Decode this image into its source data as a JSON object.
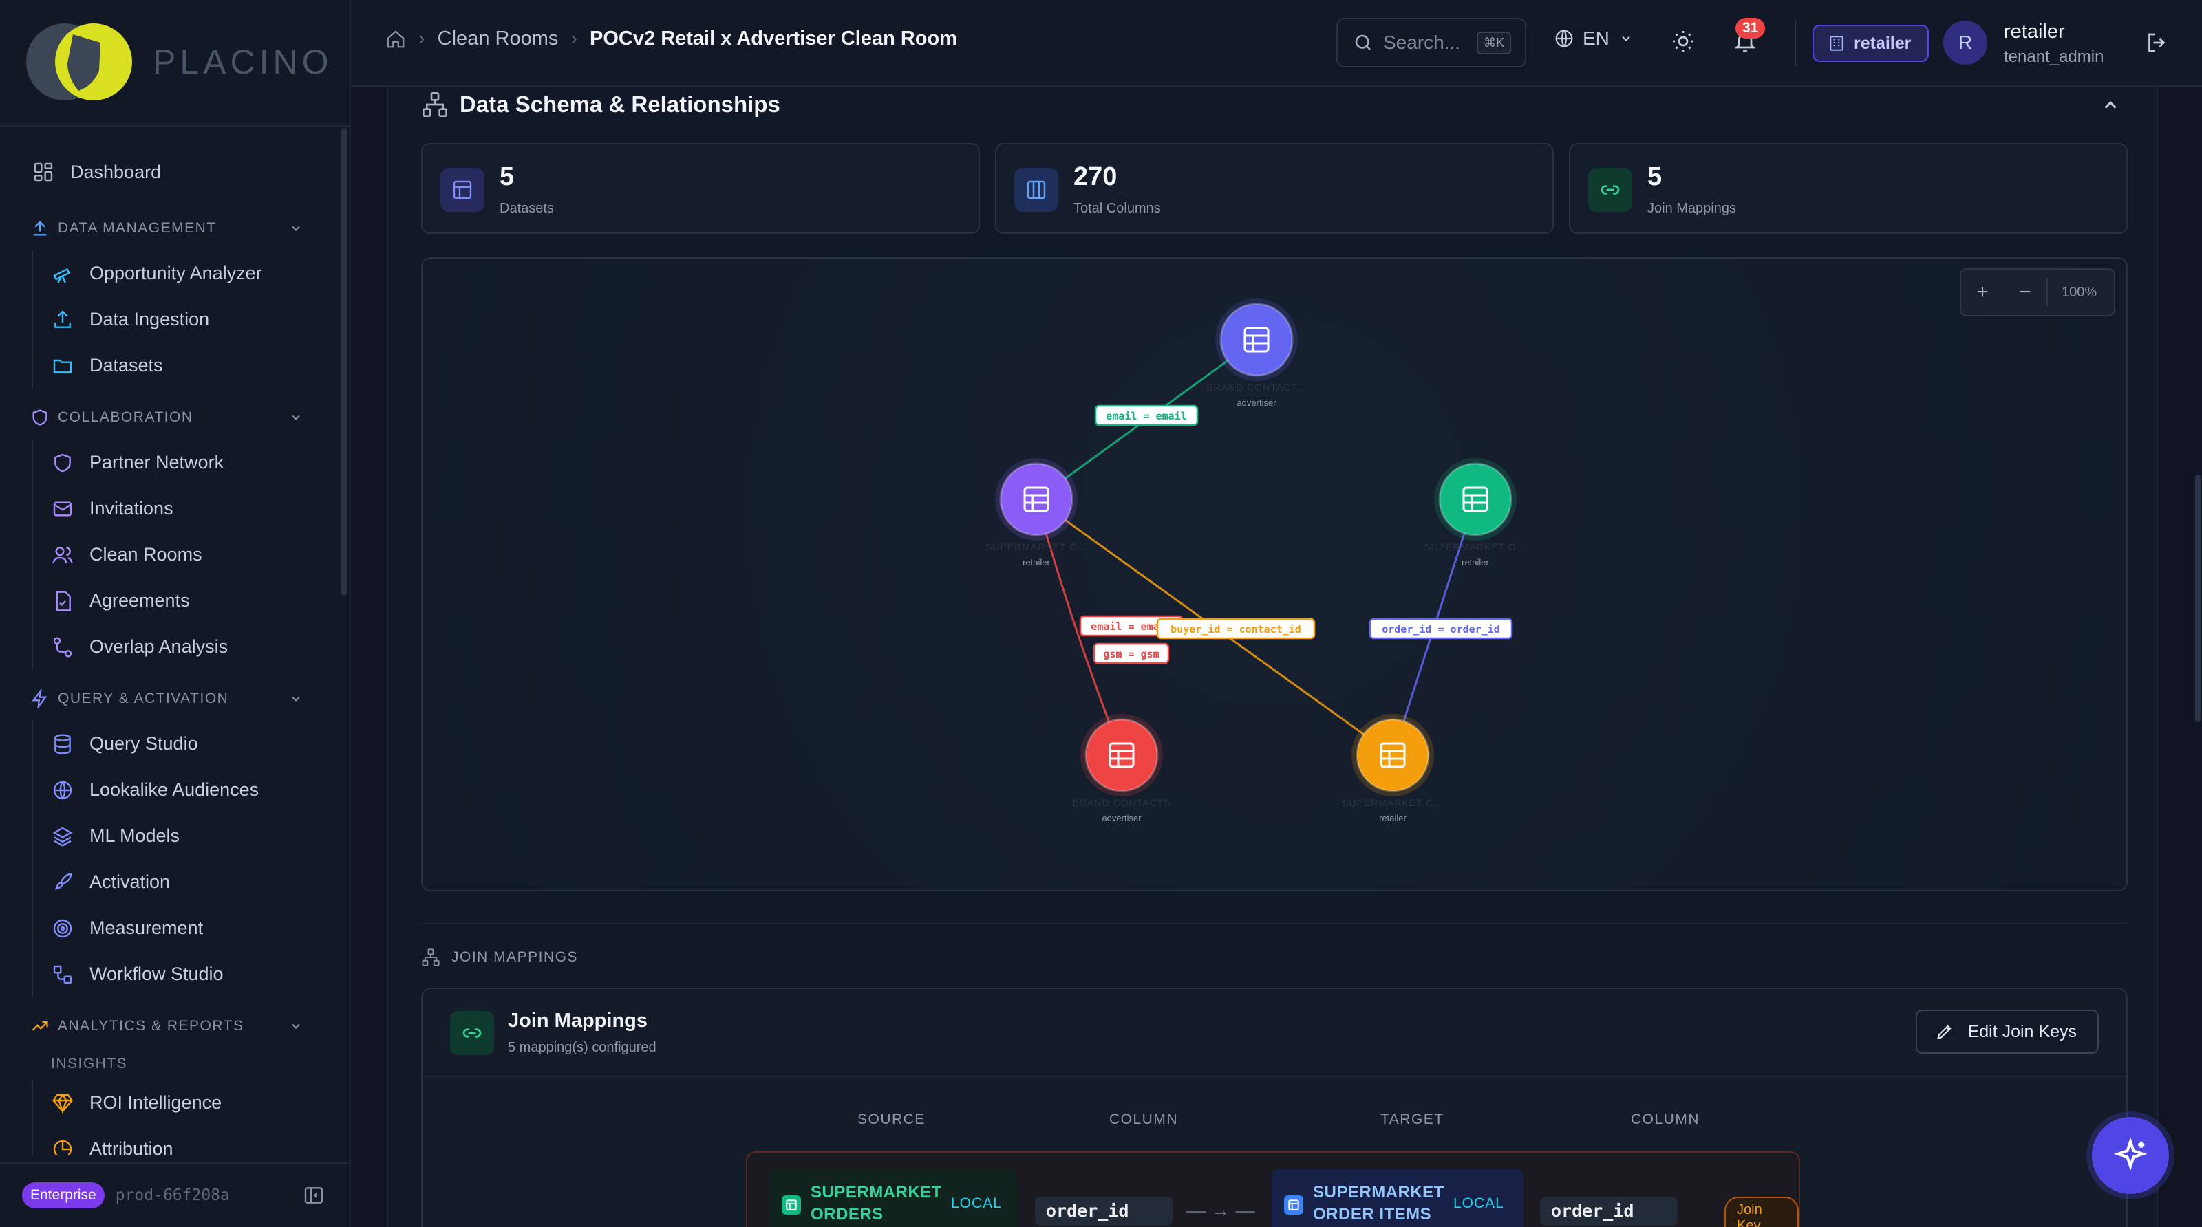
{
  "brand": {
    "name": "PLACINO"
  },
  "sidebar": {
    "dashboard": "Dashboard",
    "sections": [
      {
        "label": "DATA MANAGEMENT",
        "items": [
          "Opportunity Analyzer",
          "Data Ingestion",
          "Datasets"
        ]
      },
      {
        "label": "COLLABORATION",
        "items": [
          "Partner Network",
          "Invitations",
          "Clean Rooms",
          "Agreements",
          "Overlap Analysis"
        ]
      },
      {
        "label": "QUERY & ACTIVATION",
        "items": [
          "Query Studio",
          "Lookalike Audiences",
          "ML Models",
          "Activation",
          "Measurement",
          "Workflow Studio"
        ]
      },
      {
        "label": "ANALYTICS & REPORTS",
        "subsection": "INSIGHTS",
        "items": [
          "ROI Intelligence",
          "Attribution"
        ]
      }
    ],
    "footer": {
      "badge": "Enterprise",
      "env": "prod-66f208a"
    }
  },
  "topbar": {
    "breadcrumb": [
      "Clean Rooms",
      "POCv2 Retail x Advertiser Clean Room"
    ],
    "search_placeholder": "Search...",
    "search_shortcut": "⌘K",
    "language": "EN",
    "notifications": "31",
    "role_badge": "retailer",
    "avatar_initial": "R",
    "user_name": "retailer",
    "user_role": "tenant_admin"
  },
  "schema": {
    "title": "Data Schema & Relationships",
    "stats": [
      {
        "value": "5",
        "label": "Datasets"
      },
      {
        "value": "270",
        "label": "Total Columns"
      },
      {
        "value": "5",
        "label": "Join Mappings"
      }
    ],
    "zoom": {
      "plus": "+",
      "minus": "−",
      "level": "100%"
    },
    "nodes": [
      {
        "id": "n1",
        "name": "BRAND CONTACT...",
        "owner": "advertiser",
        "color": "#6366f1"
      },
      {
        "id": "n2",
        "name": "SUPERMARKET C...",
        "owner": "retailer",
        "color": "#8b5cf6"
      },
      {
        "id": "n3",
        "name": "SUPERMARKET O...",
        "owner": "retailer",
        "color": "#10b981"
      },
      {
        "id": "n4",
        "name": "BRAND CONTACTS",
        "owner": "advertiser",
        "color": "#ef4444"
      },
      {
        "id": "n5",
        "name": "SUPERMARKET C...",
        "owner": "retailer",
        "color": "#f59e0b"
      }
    ],
    "edges": [
      {
        "label": "email = email",
        "color": "#10b981"
      },
      {
        "label": "email = email",
        "color": "#ef4444"
      },
      {
        "label": "gsm = gsm",
        "color": "#ef4444"
      },
      {
        "label": "buyer_id = contact_id",
        "color": "#f59e0b"
      },
      {
        "label": "order_id = order_id",
        "color": "#6366f1"
      }
    ]
  },
  "join_mappings": {
    "section_label": "JOIN MAPPINGS",
    "title": "Join Mappings",
    "subtitle": "5 mapping(s) configured",
    "edit_button": "Edit Join Keys",
    "headers": [
      "SOURCE",
      "COLUMN",
      "TARGET",
      "COLUMN"
    ],
    "rows": [
      {
        "source": "SUPERMARKET ORDERS",
        "source_tag": "LOCAL",
        "source_column": "order_id",
        "target": "SUPERMARKET ORDER ITEMS",
        "target_tag": "LOCAL",
        "target_column": "order_id",
        "badge": "Join Key"
      }
    ]
  }
}
